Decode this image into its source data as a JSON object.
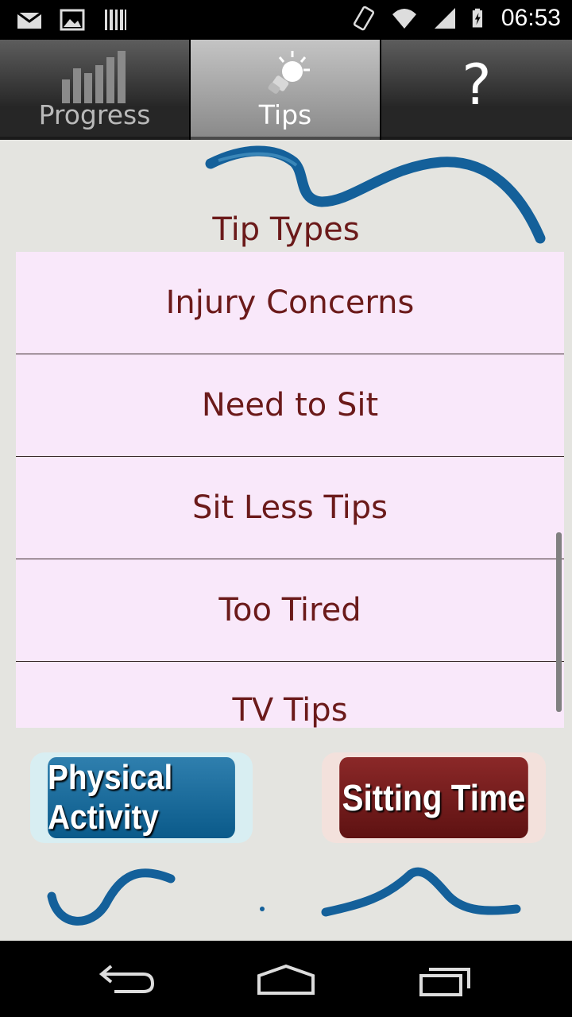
{
  "status_bar": {
    "time": "06:53",
    "left_icons": [
      "mail-icon",
      "image-icon",
      "barcode-icon"
    ],
    "right_icons": [
      "rotate-icon",
      "wifi-icon",
      "signal-icon",
      "battery-charging-icon"
    ]
  },
  "tabs": [
    {
      "label": "Progress",
      "icon": "bar-chart-icon",
      "active": false
    },
    {
      "label": "Tips",
      "icon": "lightbulb-icon",
      "active": true
    },
    {
      "label": "?",
      "icon": "help-icon",
      "active": false
    }
  ],
  "content": {
    "heading": "Tip Types",
    "items": [
      "Injury Concerns",
      "Need to Sit",
      "Sit Less Tips",
      "Too Tired",
      "TV Tips"
    ]
  },
  "buttons": {
    "physical_activity": "Physical Activity",
    "sitting_time": "Sitting Time"
  },
  "colors": {
    "text_maroon": "#6b1a1a",
    "list_background": "#f9e8fa",
    "brush_blue": "#14609a",
    "button_blue": "#0a5a8a",
    "button_maroon": "#5e1212"
  },
  "nav_bar": [
    "back-icon",
    "home-icon",
    "recents-icon"
  ]
}
